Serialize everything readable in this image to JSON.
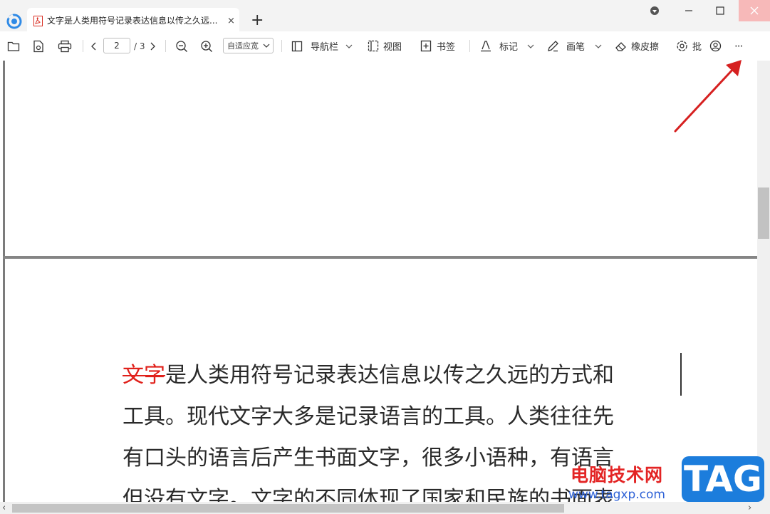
{
  "tab": {
    "title": "文字是人类用符号记录表达信息以传之久远...",
    "close": "×",
    "new_tab": "+"
  },
  "toolbar": {
    "page_current": "2",
    "page_total": "/ 3",
    "zoom_mode": "自适应宽",
    "nav_label": "导航栏",
    "view_label": "视图",
    "bookmark_label": "书签",
    "mark_label": "标记",
    "pen_label": "画笔",
    "eraser_label": "橡皮擦",
    "comment_label": "批",
    "more": "···"
  },
  "document": {
    "line1_struck": "文字",
    "line1_rest": "是人类用符号记录表达信息以传之久远的方式和",
    "line2": "工具。现代文字大多是记录语言的工具。人类往往先",
    "line3": "有口头的语言后产生书面文字，很多小语种，有语言",
    "line4": "但没有文字。文字的不同体现了国家和民族的书面表"
  },
  "watermark": {
    "site_name": "电脑技术网",
    "site_url": "www.tagxp.com",
    "badge": "TAG"
  },
  "colors": {
    "accent_red": "#e0201a",
    "annotation_arrow": "#d62020",
    "close_hover": "#f7b9b9",
    "badge_blue": "#1c7ddc"
  }
}
